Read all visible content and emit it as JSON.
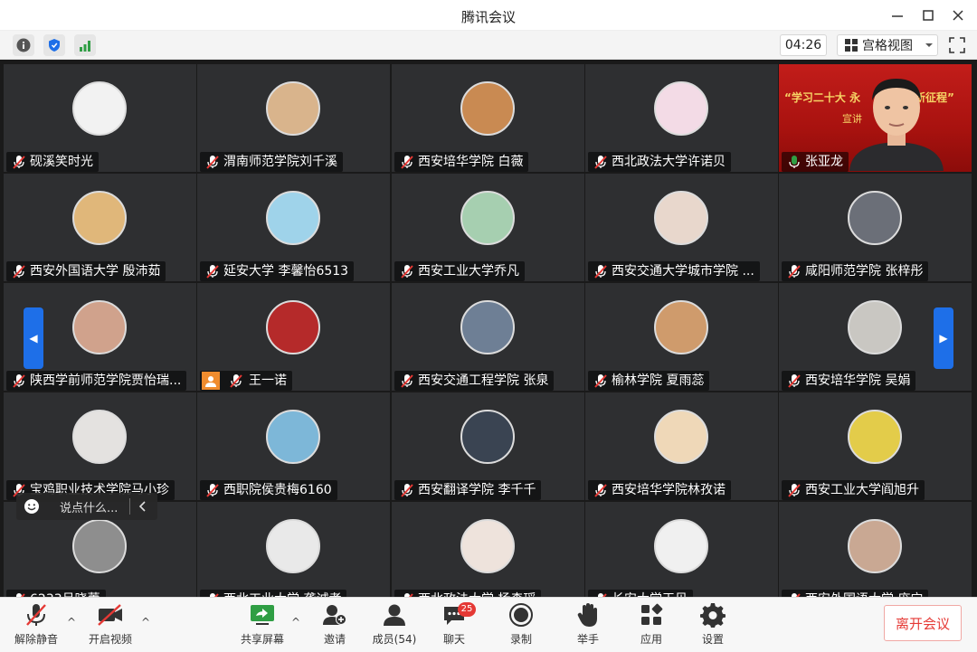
{
  "window": {
    "title": "腾讯会议"
  },
  "header": {
    "timer": "04:26",
    "view_mode": "宫格视图"
  },
  "participants": [
    {
      "name": "砚溪笑时光",
      "avatar_color": "#f2f2f2"
    },
    {
      "name": "渭南师范学院刘千溪",
      "avatar_color": "#d9b48c"
    },
    {
      "name": "西安培华学院 白薇",
      "avatar_color": "#c98a52"
    },
    {
      "name": "西北政法大学许诺贝",
      "avatar_color": "#f3dbe6"
    },
    {
      "name": "张亚龙",
      "avatar_color": "#c21d1a"
    },
    {
      "name": "西安外国语大学 殷沛茹",
      "avatar_color": "#e0b77a"
    },
    {
      "name": "延安大学 李馨怡6513",
      "avatar_color": "#9fd3ea"
    },
    {
      "name": "西安工业大学乔凡",
      "avatar_color": "#a6cfb0"
    },
    {
      "name": "西安交通大学城市学院 ...",
      "avatar_color": "#e8d7cc"
    },
    {
      "name": "咸阳师范学院 张梓彤",
      "avatar_color": "#6b6f78"
    },
    {
      "name": "陕西学前师范学院贾怡瑞...",
      "avatar_color": "#d0a28c"
    },
    {
      "name": "王一诺",
      "avatar_color": "#b52a2a"
    },
    {
      "name": "西安交通工程学院 张泉",
      "avatar_color": "#6e7f95"
    },
    {
      "name": "榆林学院 夏雨蕊",
      "avatar_color": "#cf9b6c"
    },
    {
      "name": "西安培华学院 吴娟",
      "avatar_color": "#c9c7c2"
    },
    {
      "name": "宝鸡职业技术学院马小珍",
      "avatar_color": "#e4e2e0"
    },
    {
      "name": "西职院侯贵梅6160",
      "avatar_color": "#7db7d8"
    },
    {
      "name": "西安翻译学院 李千千",
      "avatar_color": "#3a4452"
    },
    {
      "name": "西安培华学院林孜诺",
      "avatar_color": "#efd8b8"
    },
    {
      "name": "西安工业大学阎旭升",
      "avatar_color": "#e3cc4a"
    },
    {
      "name": "6233吕晓蕾",
      "avatar_color": "#8e8e8e"
    },
    {
      "name": "西北工业大学 龚诚孝",
      "avatar_color": "#e9e9e9"
    },
    {
      "name": "西北政法大学 杨森瑶",
      "avatar_color": "#eee3dc"
    },
    {
      "name": "长安大学王贝",
      "avatar_color": "#f0f0f0"
    },
    {
      "name": "西安外国语大学 庞宁",
      "avatar_color": "#c9a893"
    }
  ],
  "video_overlay": {
    "banner": "“学习二十大 永",
    "banner_right": "进新征程”",
    "sub": "宣讲"
  },
  "chat_input": {
    "placeholder": "说点什么..."
  },
  "toolbar": {
    "unmute": "解除静音",
    "start_video": "开启视频",
    "share_screen": "共享屏幕",
    "invite": "邀请",
    "members": "成员(54)",
    "chat": "聊天",
    "chat_badge": "25",
    "record": "录制",
    "raise_hand": "举手",
    "apps": "应用",
    "settings": "设置",
    "leave": "离开会议"
  },
  "colors": {
    "accent": "#1e6fe8",
    "danger": "#e53935",
    "share_green": "#2f9e44",
    "tile_bg": "#2e2f31"
  }
}
